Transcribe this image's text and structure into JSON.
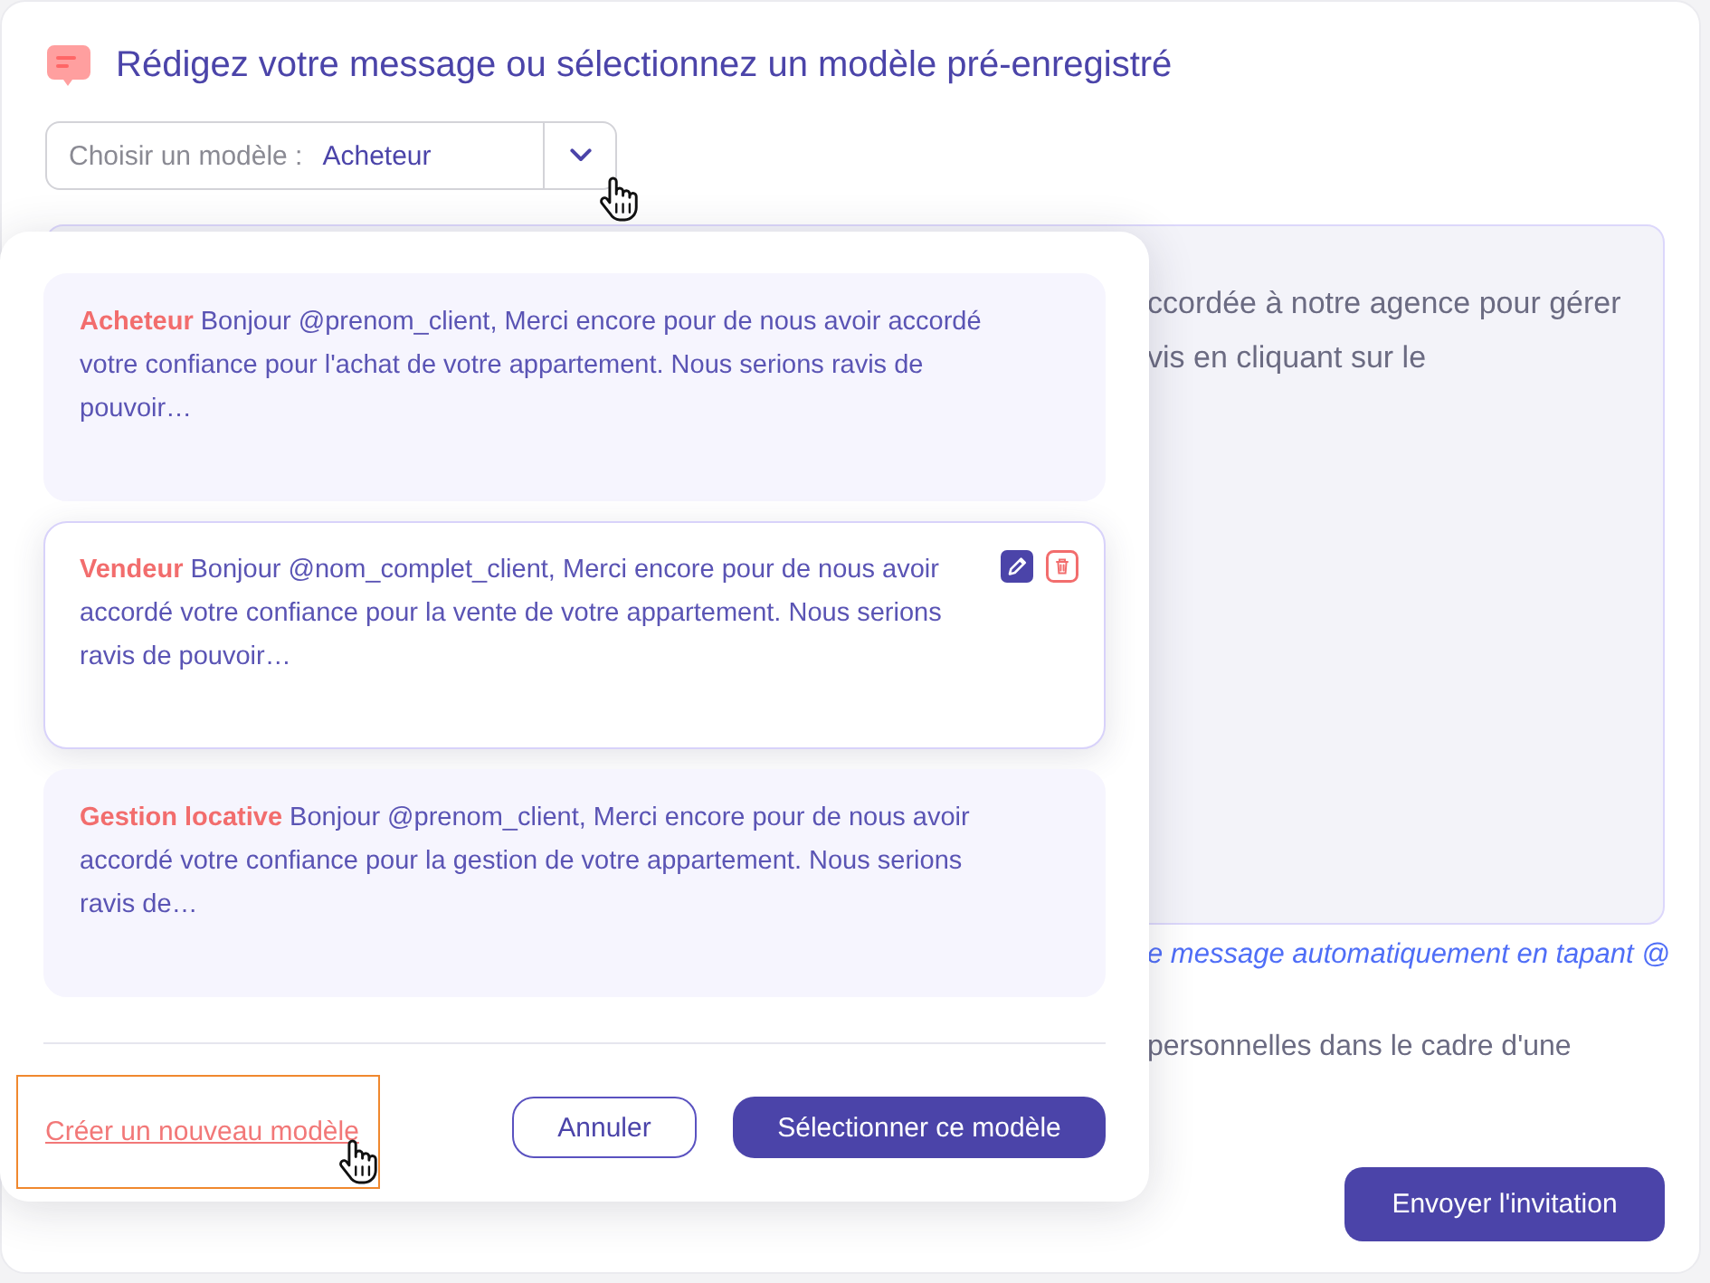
{
  "header": {
    "title": "Rédigez votre message ou sélectionnez un modèle pré-enregistré"
  },
  "template_select": {
    "label": "Choisir un modèle :",
    "value": "Acheteur"
  },
  "message": {
    "visible_lines": [
      "ccordée à notre agence pour gérer",
      "vis en cliquant sur le"
    ]
  },
  "hint": "e message automatiquement en tapant @",
  "consent_text": "personnelles dans le cadre d'une",
  "send_button": "Envoyer l'invitation",
  "template_popup": {
    "templates": [
      {
        "name": "Acheteur",
        "text": "Bonjour @prenom_client, Merci encore pour de nous avoir accordé votre confiance pour l'achat de votre appartement. Nous serions ravis de pouvoir…",
        "selected": false
      },
      {
        "name": "Vendeur",
        "text": "Bonjour @nom_complet_client, Merci encore pour de nous avoir accordé votre confiance pour la vente de votre appartement. Nous serions ravis de pouvoir…",
        "selected": true
      },
      {
        "name": "Gestion locative",
        "text": "Bonjour @prenom_client, Merci encore pour de nous avoir accordé votre confiance pour la gestion de votre appartement. Nous serions ravis de…",
        "selected": false
      }
    ],
    "create_link": "Créer un nouveau modèle",
    "cancel_button": "Annuler",
    "confirm_button": "Sélectionner ce modèle"
  }
}
